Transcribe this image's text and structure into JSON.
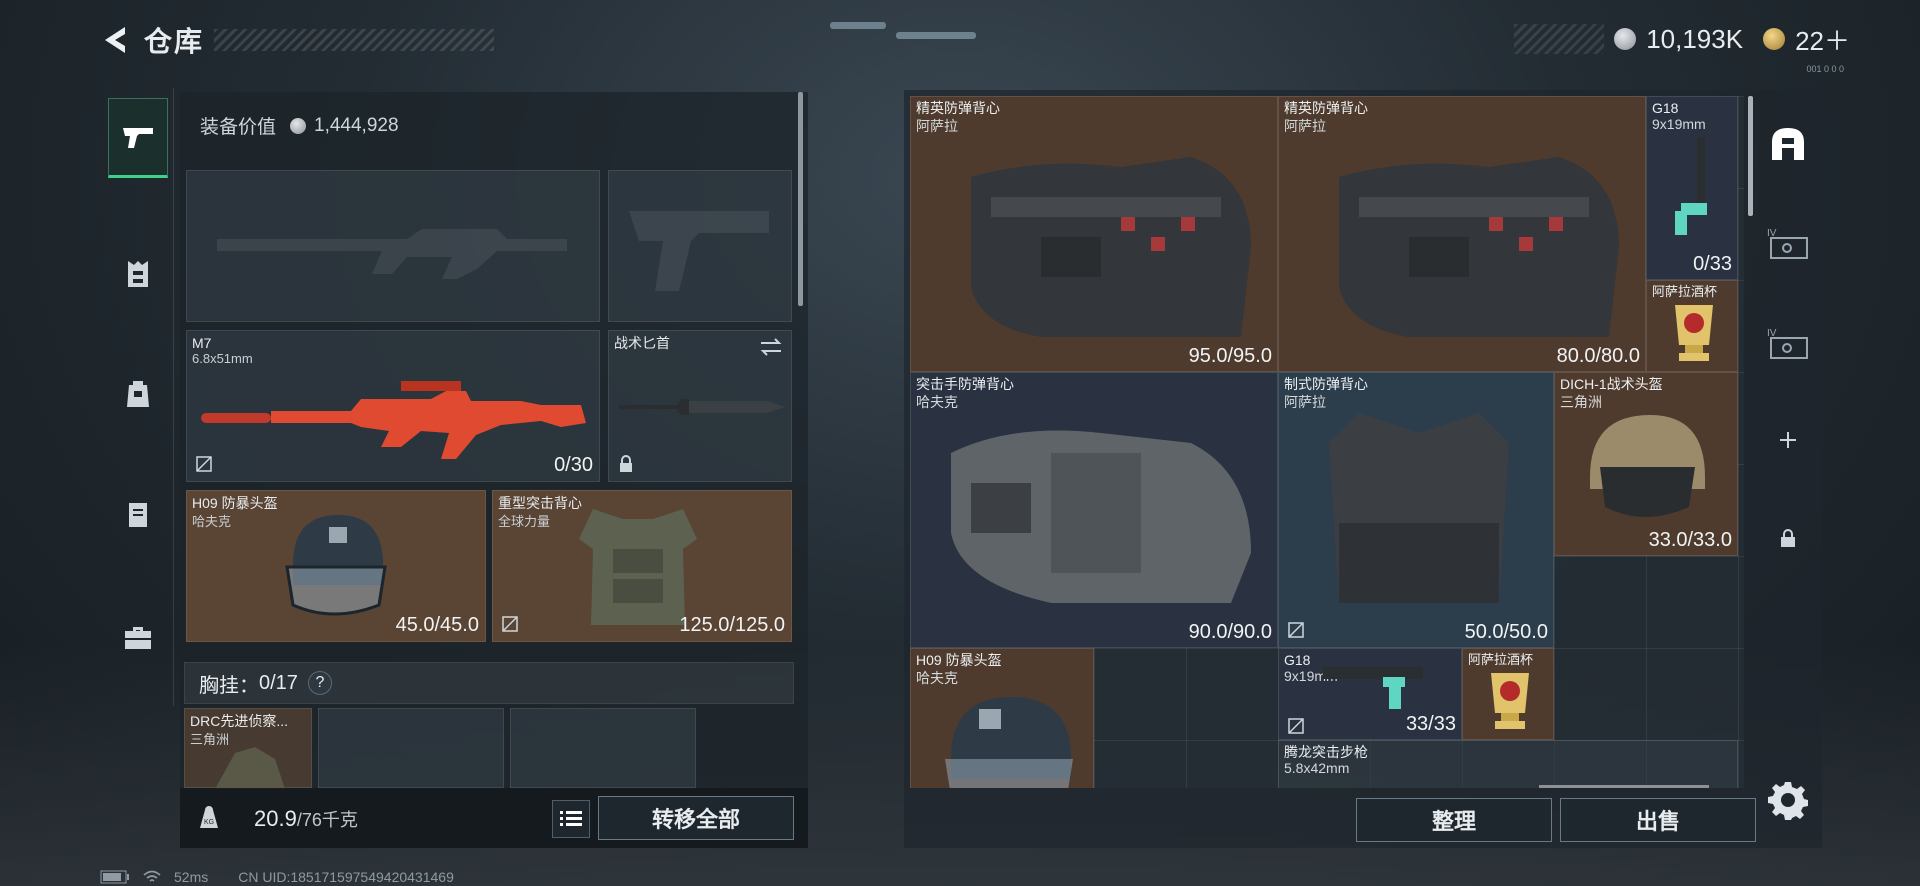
{
  "header": {
    "title": "仓库",
    "currency": [
      {
        "icon": "silver-coin-icon",
        "value": "10,193K"
      },
      {
        "icon": "gold-coin-icon",
        "value": "22＋"
      }
    ],
    "version": "001 0 0 0"
  },
  "left_nav": {
    "items": [
      {
        "name": "weapons",
        "icon": "pistol-icon",
        "active": true
      },
      {
        "name": "armor",
        "icon": "armor-icon",
        "active": false
      },
      {
        "name": "backpack",
        "icon": "backpack-icon",
        "active": false
      },
      {
        "name": "container",
        "icon": "clipboard-icon",
        "active": false
      },
      {
        "name": "case",
        "icon": "toolbox-icon",
        "active": false
      }
    ]
  },
  "equipment": {
    "value_label": "装备价值",
    "value": "1,444,928",
    "primary_weapon": {
      "name": "M7",
      "caliber": "6.8x51mm",
      "ammo": "0/30"
    },
    "melee": {
      "name": "战术匕首"
    },
    "helmet": {
      "name": "H09 防暴头盔",
      "brand": "哈夫克",
      "durability": "45.0/45.0"
    },
    "armor": {
      "name": "重型突击背心",
      "brand": "全球力量",
      "durability": "125.0/125.0"
    },
    "chest_rig": {
      "label": "胸挂：",
      "count": "0/17",
      "help": "?"
    },
    "rig_item": {
      "name": "DRC先进侦察...",
      "brand": "三角洲"
    },
    "weight": {
      "current": "20.9",
      "max": "/76千克"
    },
    "transfer_all": "转移全部"
  },
  "stash": {
    "items": [
      {
        "name": "精英防弹背心",
        "brand": "阿萨拉",
        "durability": "95.0/95.0"
      },
      {
        "name": "精英防弹背心",
        "brand": "阿萨拉",
        "durability": "80.0/80.0"
      },
      {
        "name": "G18",
        "caliber": "9x19mm",
        "ammo": "0/33"
      },
      {
        "name": "阿萨拉酒杯"
      },
      {
        "name": "突击手防弹背心",
        "brand": "哈夫克",
        "durability": "90.0/90.0"
      },
      {
        "name": "制式防弹背心",
        "brand": "阿萨拉",
        "durability": "50.0/50.0"
      },
      {
        "name": "DICH-1战术头盔",
        "brand": "三角洲",
        "durability": "33.0/33.0"
      },
      {
        "name": "H09 防暴头盔",
        "brand": "哈夫克"
      },
      {
        "name": "G18",
        "caliber": "9x19mm",
        "ammo": "33/33"
      },
      {
        "name": "阿萨拉酒杯"
      },
      {
        "name": "腾龙突击步枪",
        "caliber": "5.8x42mm"
      }
    ],
    "sort_button": "整理",
    "sell_button": "出售"
  },
  "right_nav": {
    "items": [
      {
        "icon": "stash-icon",
        "label": ""
      },
      {
        "icon": "case-icon",
        "label": "IV"
      },
      {
        "icon": "case-icon",
        "label": "IV"
      },
      {
        "icon": "plus-icon",
        "label": "+"
      },
      {
        "icon": "lock-icon",
        "label": ""
      }
    ]
  },
  "status": {
    "ping": "52ms",
    "uid": "CN UID:18517159754942043146​9"
  },
  "colors": {
    "accent_green": "#3fd08a",
    "item_brown": "#5a4434",
    "item_blue": "#2c3d4b",
    "weapon_red": "#e04a30"
  }
}
